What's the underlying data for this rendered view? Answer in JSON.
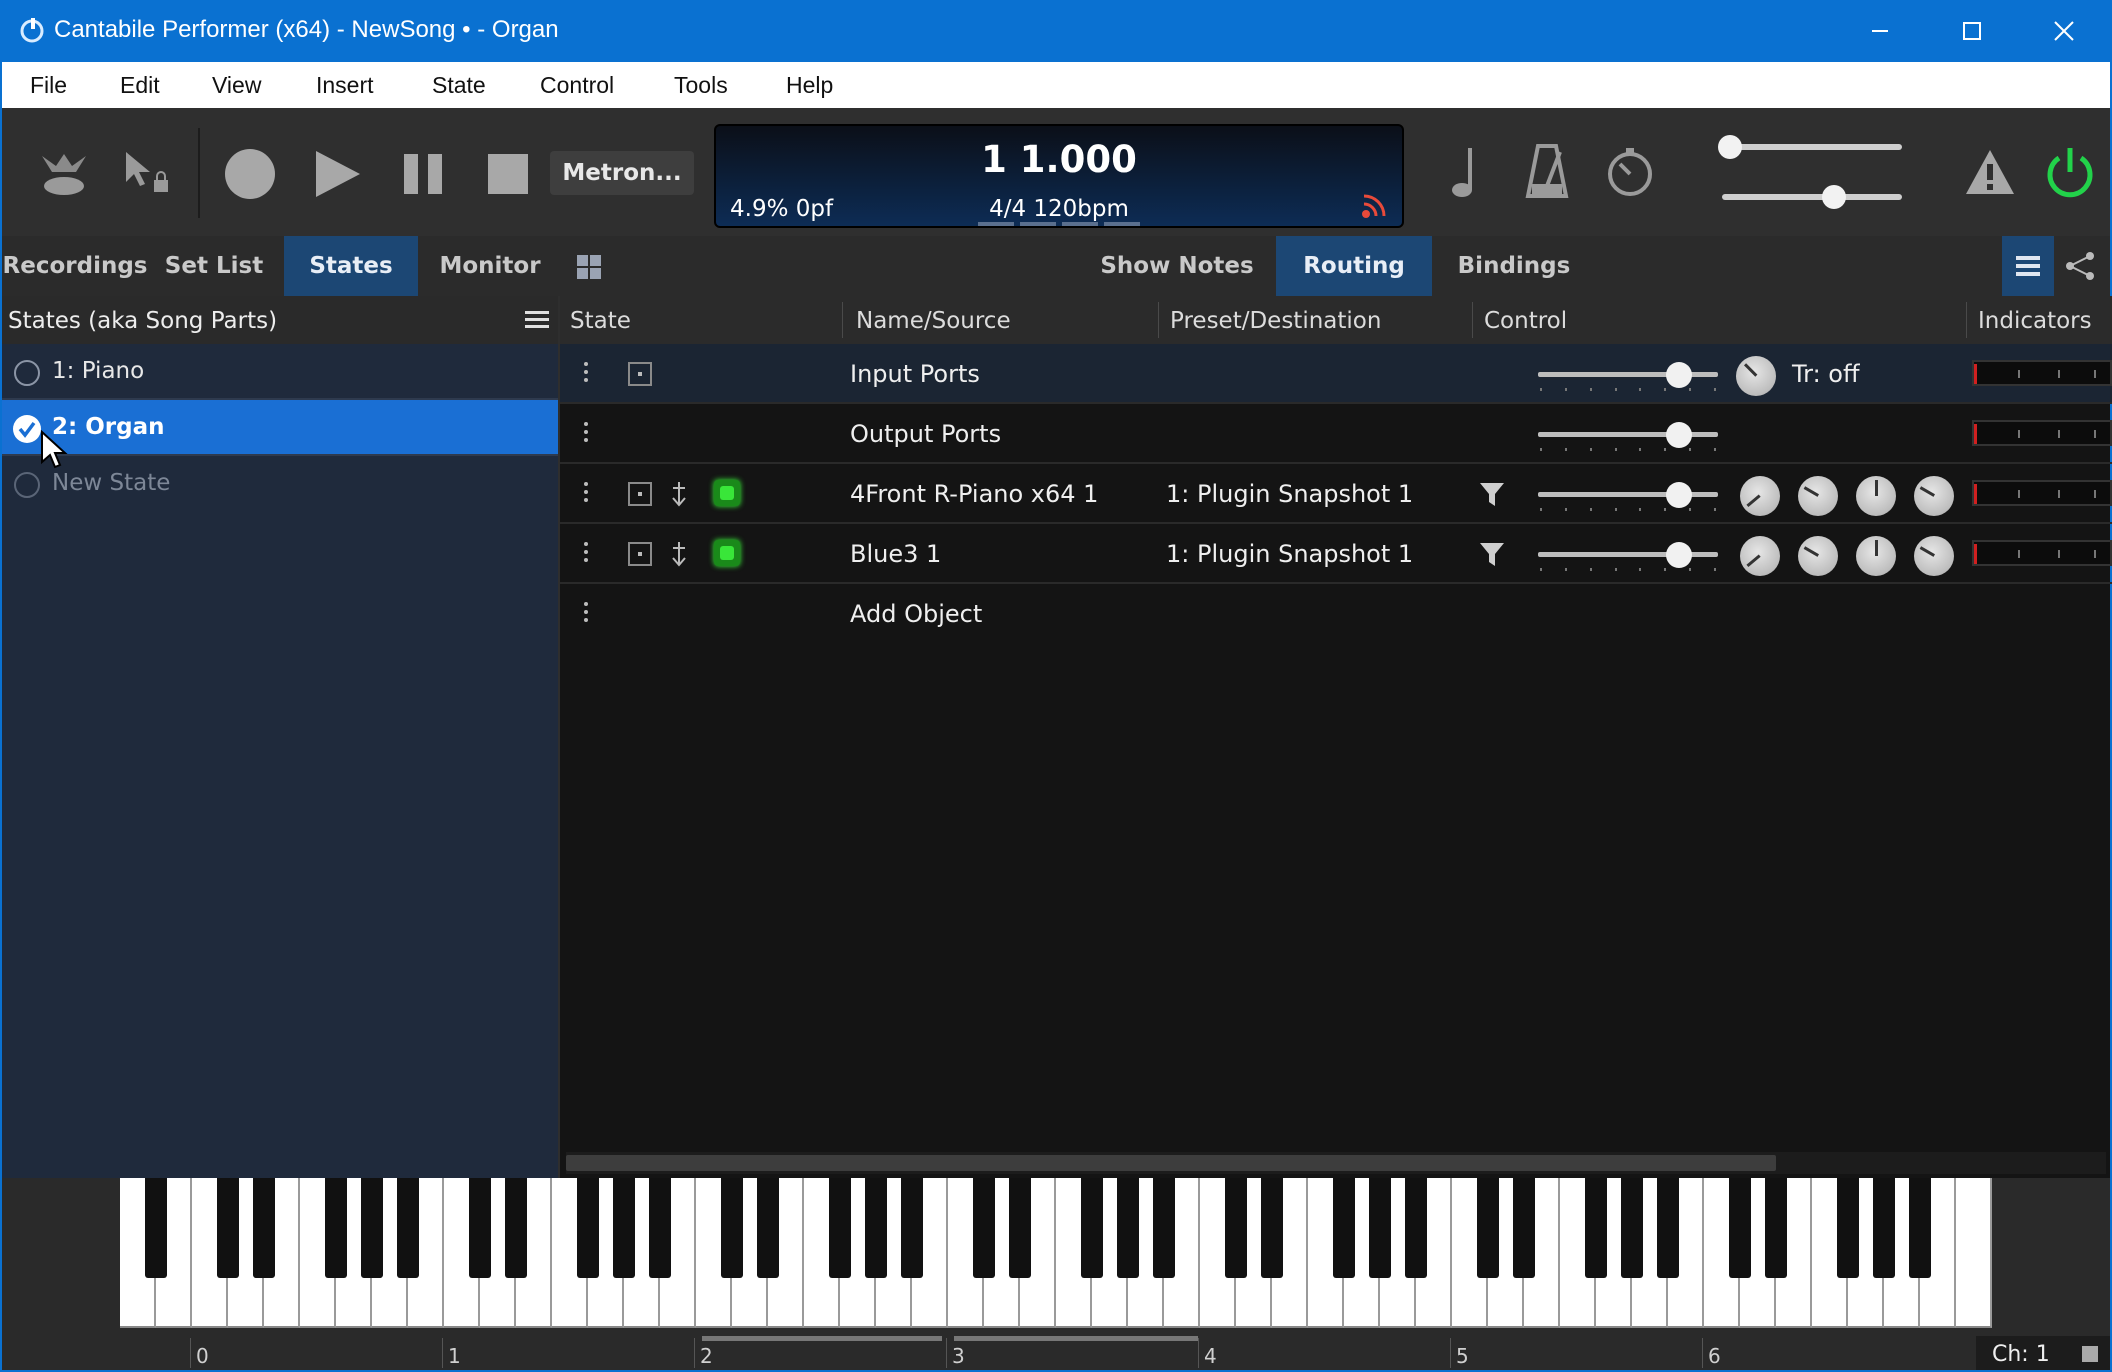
{
  "window": {
    "title": "Cantabile Performer (x64) - NewSong • - Organ"
  },
  "menu": [
    "File",
    "Edit",
    "View",
    "Insert",
    "State",
    "Control",
    "Tools",
    "Help"
  ],
  "toolbar": {
    "metronome_label": "Metron...",
    "position": "1 1.000",
    "load": "4.9%  0pf",
    "tempo": "4/4 120bpm",
    "accent_color": "#0a71d1",
    "power_color": "#22d24a"
  },
  "tabs_left": [
    "Recordings",
    "Set List",
    "States",
    "Monitor"
  ],
  "tabs_left_active": "States",
  "tabs_right": [
    "Show Notes",
    "Routing",
    "Bindings"
  ],
  "tabs_right_active": "Routing",
  "states_panel": {
    "header": "States (aka Song Parts)",
    "items": [
      {
        "label": "1: Piano",
        "selected": false
      },
      {
        "label": "2: Organ",
        "selected": true
      },
      {
        "label": "New State",
        "selected": false
      }
    ]
  },
  "routing": {
    "columns": [
      "State",
      "Name/Source",
      "Preset/Destination",
      "Control",
      "Indicators"
    ],
    "rows": [
      {
        "name": "Input Ports",
        "preset": "",
        "extra": "Tr: off"
      },
      {
        "name": "Output Ports",
        "preset": ""
      },
      {
        "name": "4Front R-Piano x64 1",
        "preset": "1: Plugin Snapshot 1"
      },
      {
        "name": "Blue3 1",
        "preset": "1: Plugin Snapshot 1"
      },
      {
        "name": "Add Object",
        "preset": ""
      }
    ]
  },
  "keyboard": {
    "octave_labels": [
      "0",
      "1",
      "2",
      "3",
      "4",
      "5",
      "6"
    ],
    "channel": "Ch: 1"
  }
}
